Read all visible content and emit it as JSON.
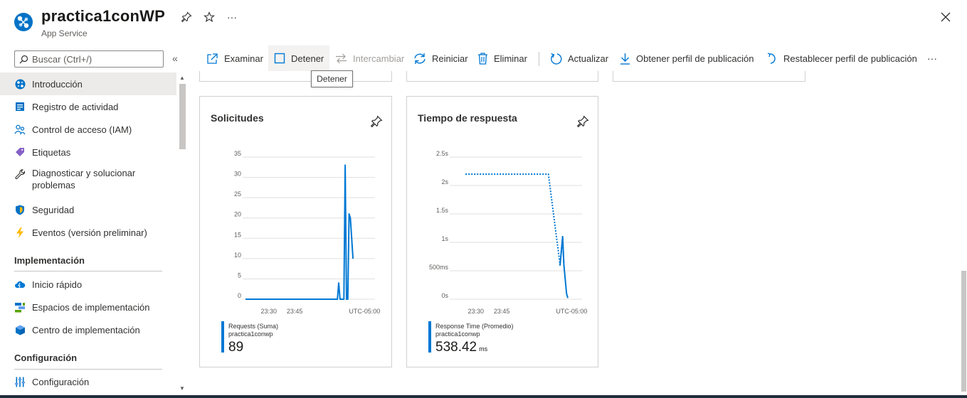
{
  "header": {
    "title": "practica1conWP",
    "subtitle": "App Service",
    "icons": [
      "app-service-icon",
      "pin-icon",
      "star-icon",
      "more-icon",
      "close-icon"
    ],
    "more_label": "···"
  },
  "sidebar": {
    "search_placeholder": "Buscar (Ctrl+/)",
    "collapse_label": "«",
    "items": [
      {
        "label": "Introducción",
        "icon": "overview-icon",
        "active": true
      },
      {
        "label": "Registro de actividad",
        "icon": "activity-log-icon"
      },
      {
        "label": "Control de acceso (IAM)",
        "icon": "iam-icon"
      },
      {
        "label": "Etiquetas",
        "icon": "tag-icon"
      },
      {
        "label": "Diagnosticar y solucionar problemas",
        "icon": "wrench-icon"
      },
      {
        "label": "Seguridad",
        "icon": "shield-icon"
      },
      {
        "label": "Eventos (versión preliminar)",
        "icon": "lightning-icon"
      }
    ],
    "sections": [
      {
        "title": "Implementación",
        "items": [
          {
            "label": "Inicio rápido",
            "icon": "cloud-icon"
          },
          {
            "label": "Espacios de implementación",
            "icon": "slots-icon"
          },
          {
            "label": "Centro de implementación",
            "icon": "cube-icon"
          }
        ]
      },
      {
        "title": "Configuración",
        "items": [
          {
            "label": "Configuración",
            "icon": "sliders-icon"
          }
        ]
      }
    ]
  },
  "toolbar": {
    "items": [
      {
        "label": "Examinar",
        "icon": "browse-icon"
      },
      {
        "label": "Detener",
        "icon": "stop-icon"
      },
      {
        "label": "Intercambiar",
        "icon": "swap-icon",
        "disabled": true
      },
      {
        "label": "Reiniciar",
        "icon": "restart-icon"
      },
      {
        "label": "Eliminar",
        "icon": "trash-icon"
      },
      {
        "label": "Actualizar",
        "icon": "refresh-icon"
      },
      {
        "label": "Obtener perfil de publicación",
        "icon": "download-icon"
      },
      {
        "label": "Restablecer perfil de publicación",
        "icon": "reset-icon"
      }
    ],
    "more_label": "···",
    "tooltip": "Detener"
  },
  "cards": [
    {
      "title": "Solicitudes",
      "legend_name": "Requests (Suma)",
      "legend_resource": "practica1conwp",
      "legend_value": "89",
      "legend_unit": ""
    },
    {
      "title": "Tiempo de respuesta",
      "legend_name": "Response Time (Promedio)",
      "legend_resource": "practica1conwp",
      "legend_value": "538.42",
      "legend_unit": "ms"
    }
  ],
  "colors": {
    "accent": "#0078d4",
    "border": "#d2d0ce",
    "active_bg": "#edebe9"
  },
  "chart_data": [
    {
      "type": "line",
      "title": "Solicitudes",
      "y_ticks": [
        "35",
        "30",
        "25",
        "20",
        "15",
        "10",
        "5",
        "0"
      ],
      "x_ticks": [
        "23:30",
        "23:45",
        "UTC-05:00"
      ],
      "ylim": [
        0,
        35
      ],
      "series": [
        {
          "name": "Requests (Suma)",
          "style": "solid",
          "points": [
            [
              0,
              0
            ],
            [
              0.6,
              0
            ],
            [
              0.71,
              0
            ],
            [
              0.72,
              4
            ],
            [
              0.73,
              0
            ],
            [
              0.76,
              0
            ],
            [
              0.77,
              33
            ],
            [
              0.78,
              0
            ],
            [
              0.79,
              0
            ],
            [
              0.8,
              21
            ],
            [
              0.81,
              20
            ],
            [
              0.83,
              10
            ]
          ]
        }
      ]
    },
    {
      "type": "line",
      "title": "Tiempo de respuesta",
      "y_ticks": [
        "2.5s",
        "2s",
        "1.5s",
        "1s",
        "500ms",
        "0s"
      ],
      "x_ticks": [
        "23:30",
        "23:45",
        "UTC-05:00"
      ],
      "ylim": [
        0,
        2.5
      ],
      "series": [
        {
          "name": "Response Time (Promedio)",
          "style": "dotted",
          "points": [
            [
              0.1,
              2.2
            ],
            [
              0.74,
              2.2
            ],
            [
              0.83,
              0.6
            ],
            [
              0.85,
              1.1
            ],
            [
              0.86,
              0.6
            ]
          ]
        },
        {
          "name": "Response Time (Promedio)",
          "style": "solid",
          "points": [
            [
              0.83,
              0.6
            ],
            [
              0.85,
              1.1
            ],
            [
              0.86,
              0.6
            ],
            [
              0.88,
              0.1
            ],
            [
              0.89,
              0.02
            ]
          ]
        }
      ]
    }
  ]
}
